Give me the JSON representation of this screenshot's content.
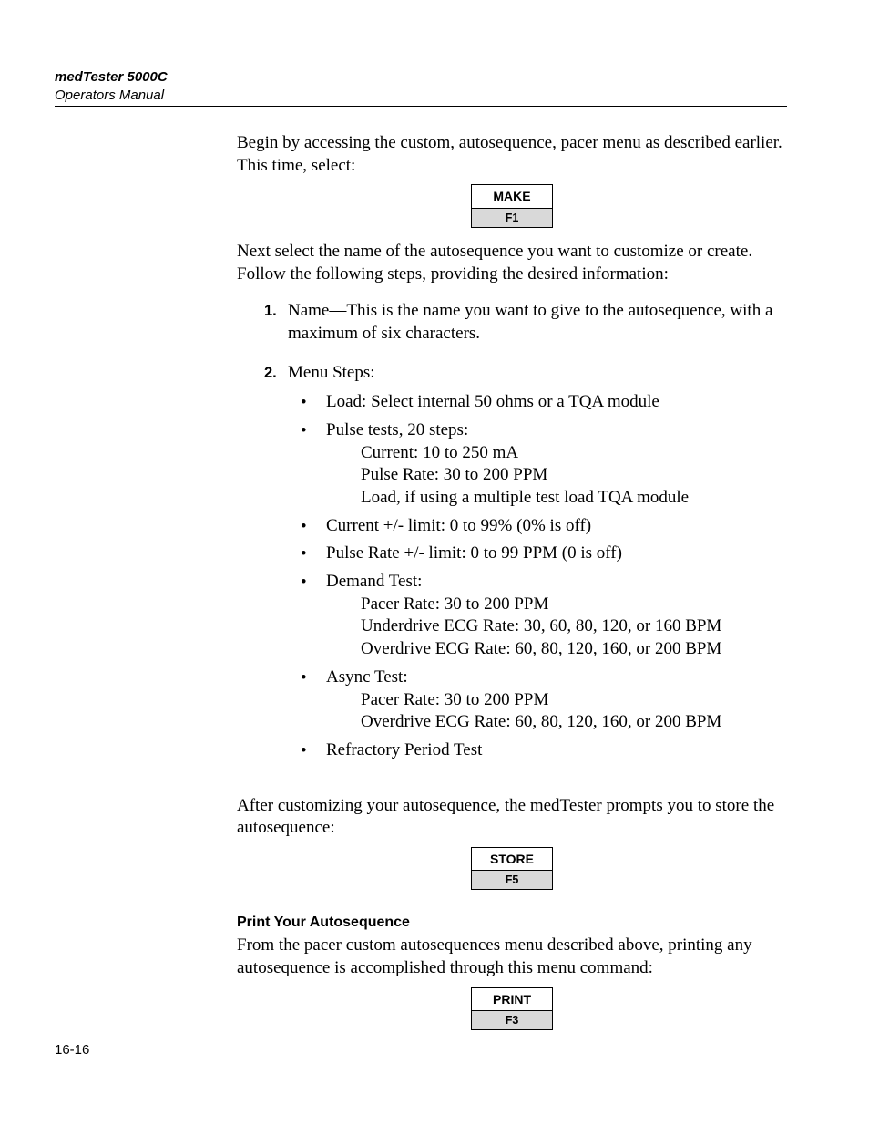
{
  "header": {
    "title": "medTester 5000C",
    "subtitle": "Operators Manual"
  },
  "intro1": "Begin by accessing the custom, autosequence, pacer menu as described earlier. This time, select:",
  "btn1": {
    "label": "MAKE",
    "key": "F1"
  },
  "intro2": "Next select the name of the autosequence you want to customize or create. Follow the following steps, providing the desired information:",
  "steps": {
    "s1_num": "1.",
    "s1_text": "Name—This is the name you want to give to the autosequence, with a maximum of six characters.",
    "s2_num": "2.",
    "s2_text": "Menu Steps:",
    "bullets": {
      "b1": "Load: Select internal 50 ohms or a TQA module",
      "b2": "Pulse tests, 20 steps:",
      "b2a": "Current: 10 to 250 mA",
      "b2b": "Pulse Rate: 30 to 200 PPM",
      "b2c": "Load, if using a multiple test load TQA module",
      "b3": "Current +/- limit: 0 to 99% (0% is off)",
      "b4": "Pulse Rate +/- limit: 0 to 99 PPM (0 is off)",
      "b5": "Demand Test:",
      "b5a": "Pacer Rate: 30 to 200 PPM",
      "b5b": "Underdrive ECG Rate:  30, 60, 80, 120, or 160 BPM",
      "b5c": "Overdrive ECG Rate: 60, 80, 120, 160, or 200 BPM",
      "b6": "Async Test:",
      "b6a": "Pacer Rate: 30 to 200 PPM",
      "b6b": "Overdrive ECG Rate: 60, 80, 120, 160, or 200 BPM",
      "b7": "Refractory Period Test"
    }
  },
  "after1": "After customizing your autosequence, the medTester prompts you to store the autosequence:",
  "btn2": {
    "label": "STORE",
    "key": "F5"
  },
  "section2": {
    "heading": "Print Your Autosequence",
    "text": "From the pacer custom autosequences menu described above, printing any autosequence is accomplished through this menu command:"
  },
  "btn3": {
    "label": "PRINT",
    "key": "F3"
  },
  "pagenum": "16-16"
}
